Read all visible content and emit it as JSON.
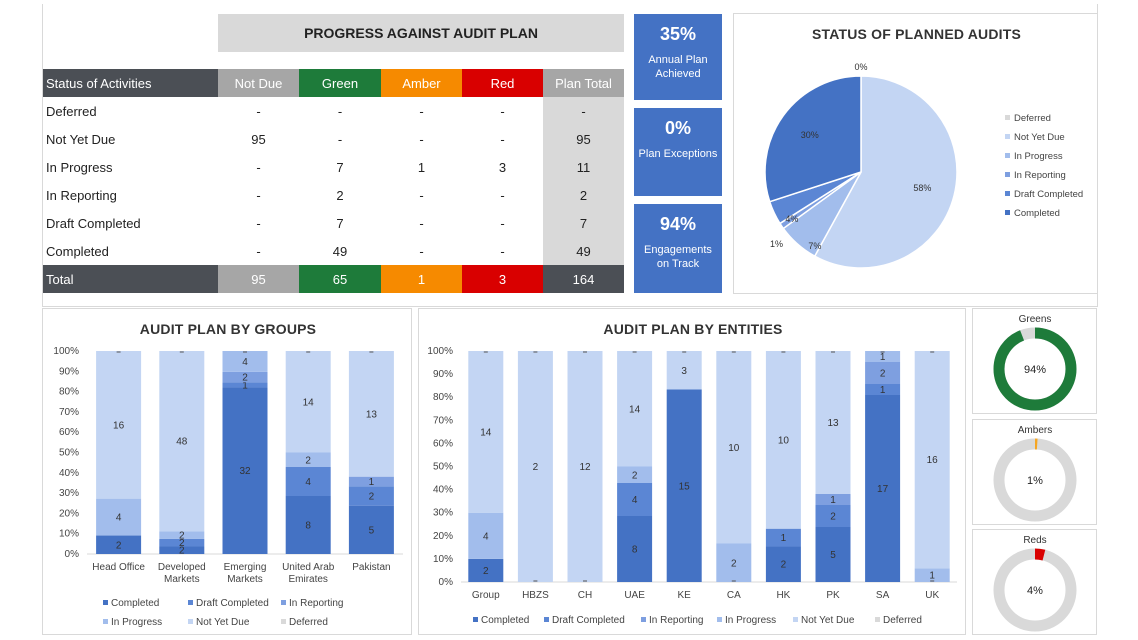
{
  "progress_table": {
    "title": "PROGRESS AGAINST AUDIT PLAN",
    "headers": [
      "Status of Activities",
      "Not Due",
      "Green",
      "Amber",
      "Red",
      "Plan Total"
    ],
    "rows": [
      {
        "label": "Deferred",
        "not_due": "-",
        "green": "-",
        "amber": "-",
        "red": "-",
        "plan_total": "-"
      },
      {
        "label": "Not Yet Due",
        "not_due": "95",
        "green": "-",
        "amber": "-",
        "red": "-",
        "plan_total": "95"
      },
      {
        "label": "In Progress",
        "not_due": "-",
        "green": "7",
        "amber": "1",
        "red": "3",
        "plan_total": "11"
      },
      {
        "label": "In Reporting",
        "not_due": "-",
        "green": "2",
        "amber": "-",
        "red": "-",
        "plan_total": "2"
      },
      {
        "label": "Draft Completed",
        "not_due": "-",
        "green": "7",
        "amber": "-",
        "red": "-",
        "plan_total": "7"
      },
      {
        "label": "Completed",
        "not_due": "-",
        "green": "49",
        "amber": "-",
        "red": "-",
        "plan_total": "49"
      }
    ],
    "total": {
      "label": "Total",
      "not_due": "95",
      "green": "65",
      "amber": "1",
      "red": "3",
      "plan_total": "164"
    }
  },
  "kpis": [
    {
      "value": "35%",
      "label": "Annual Plan Achieved"
    },
    {
      "value": "0%",
      "label": "Plan Exceptions"
    },
    {
      "value": "94%",
      "label": "Engagements on Track"
    }
  ],
  "colors": {
    "completed": "#4472c4",
    "draft_completed": "#5b86d4",
    "in_reporting": "#7e9fe0",
    "in_progress": "#a2bdec",
    "not_yet_due": "#c3d5f3",
    "deferred": "#d9d9d9",
    "green": "#1e7b3a",
    "amber": "#f5a623",
    "red": "#d90000",
    "grey": "#d9d9d9",
    "kpi": "#4472c4"
  },
  "chart_data": [
    {
      "type": "pie",
      "title": "STATUS OF PLANNED AUDITS",
      "labels": [
        "Deferred",
        "Not Yet Due",
        "In Progress",
        "In Reporting",
        "Draft Completed",
        "Completed"
      ],
      "values": [
        0,
        58,
        7,
        1,
        4,
        30
      ],
      "data_labels": [
        "0%",
        "58%",
        "7%",
        "1%",
        "4%",
        "30%"
      ],
      "legend": "right"
    },
    {
      "type": "bar",
      "stacked": "percent",
      "title": "AUDIT PLAN BY GROUPS",
      "categories": [
        [
          "Head Office"
        ],
        [
          "Developed",
          "Markets"
        ],
        [
          "Emerging",
          "Markets"
        ],
        [
          "United Arab",
          "Emirates"
        ],
        [
          "Pakistan"
        ]
      ],
      "ylim": [
        0,
        100
      ],
      "yticks": [
        "0%",
        "10%",
        "20%",
        "30%",
        "40%",
        "50%",
        "60%",
        "70%",
        "80%",
        "90%",
        "100%"
      ],
      "series": [
        {
          "name": "Completed",
          "values": [
            2,
            2,
            32,
            8,
            5
          ]
        },
        {
          "name": "Draft Completed",
          "values": [
            0,
            2,
            1,
            4,
            2
          ]
        },
        {
          "name": "In Reporting",
          "values": [
            0,
            0,
            2,
            0,
            1
          ]
        },
        {
          "name": "In Progress",
          "values": [
            4,
            2,
            4,
            2,
            0
          ]
        },
        {
          "name": "Not Yet Due",
          "values": [
            16,
            48,
            0,
            14,
            13
          ]
        },
        {
          "name": "Deferred",
          "values": [
            0,
            0,
            0,
            0,
            0
          ]
        }
      ],
      "legend": "bottom"
    },
    {
      "type": "bar",
      "stacked": "percent",
      "title": "AUDIT PLAN BY ENTITIES",
      "categories": [
        "Group",
        "HBZS",
        "CH",
        "UAE",
        "KE",
        "CA",
        "HK",
        "PK",
        "SA",
        "UK"
      ],
      "ylim": [
        0,
        100
      ],
      "yticks": [
        "0%",
        "10%",
        "20%",
        "30%",
        "40%",
        "50%",
        "60%",
        "70%",
        "80%",
        "90%",
        "100%"
      ],
      "series": [
        {
          "name": "Completed",
          "values": [
            2,
            0,
            0,
            8,
            15,
            0,
            2,
            5,
            17,
            0
          ]
        },
        {
          "name": "Draft Completed",
          "values": [
            0,
            0,
            0,
            4,
            0,
            0,
            1,
            2,
            1,
            0
          ]
        },
        {
          "name": "In Reporting",
          "values": [
            0,
            0,
            0,
            0,
            0,
            0,
            0,
            1,
            2,
            0
          ]
        },
        {
          "name": "In Progress",
          "values": [
            4,
            0,
            0,
            2,
            0,
            2,
            0,
            0,
            1,
            1
          ]
        },
        {
          "name": "Not Yet Due",
          "values": [
            14,
            2,
            12,
            14,
            3,
            10,
            10,
            13,
            0,
            16
          ]
        },
        {
          "name": "Deferred",
          "values": [
            0,
            0,
            0,
            0,
            0,
            0,
            0,
            0,
            0,
            0
          ]
        }
      ],
      "legend": "bottom"
    },
    {
      "type": "pie",
      "variant": "donut",
      "title": "Greens",
      "values": [
        94,
        6
      ],
      "data_label": "94%"
    },
    {
      "type": "pie",
      "variant": "donut",
      "title": "Ambers",
      "values": [
        1,
        99
      ],
      "data_label": "1%"
    },
    {
      "type": "pie",
      "variant": "donut",
      "title": "Reds",
      "values": [
        4,
        96
      ],
      "data_label": "4%"
    }
  ]
}
